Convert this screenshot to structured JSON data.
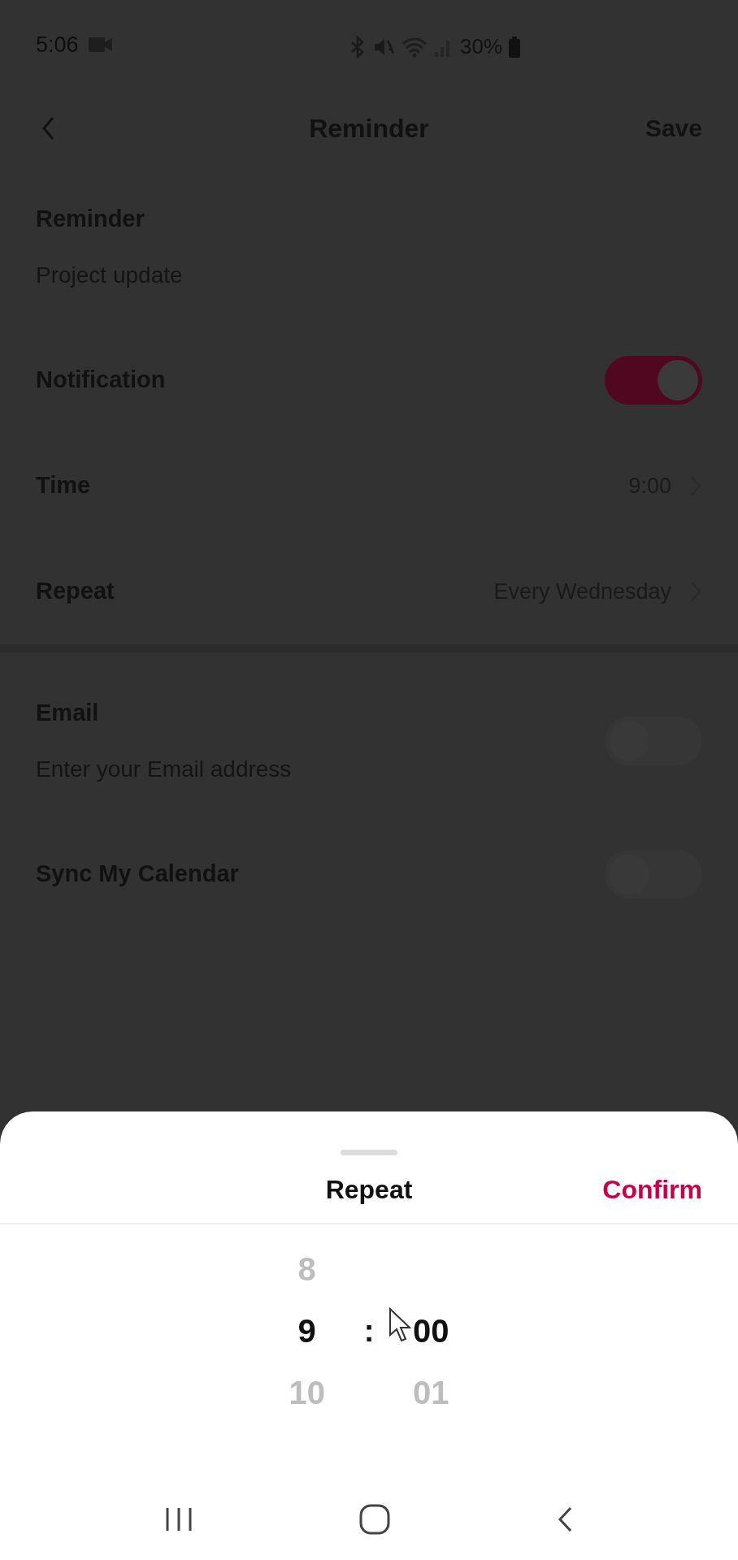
{
  "status_bar": {
    "time": "5:06",
    "battery": "30%"
  },
  "header": {
    "title": "Reminder",
    "action": "Save"
  },
  "sections": [
    {
      "fields": [
        {
          "kind": "input",
          "label": "Reminder",
          "placeholder": "Project update"
        },
        {
          "kind": "toggle",
          "label": "Notification",
          "on": true
        },
        {
          "kind": "link",
          "label": "Time",
          "value": "9:00"
        },
        {
          "kind": "link",
          "label": "Repeat",
          "value": "Every Wednesday"
        }
      ]
    },
    {
      "fields": [
        {
          "kind": "input_toggle",
          "label": "Email",
          "placeholder": "Enter your Email address",
          "on": false
        },
        {
          "kind": "toggle",
          "label": "Sync My Calendar",
          "on": false
        }
      ]
    }
  ],
  "sheet": {
    "title": "Repeat",
    "confirm": "Confirm",
    "separator": ":",
    "hours": [
      {
        "label": "8",
        "selected": false
      },
      {
        "label": "9",
        "selected": true
      },
      {
        "label": "10",
        "selected": false
      }
    ],
    "minutes": [
      {
        "label": "00",
        "selected": true
      },
      {
        "label": "01",
        "selected": false
      }
    ]
  }
}
